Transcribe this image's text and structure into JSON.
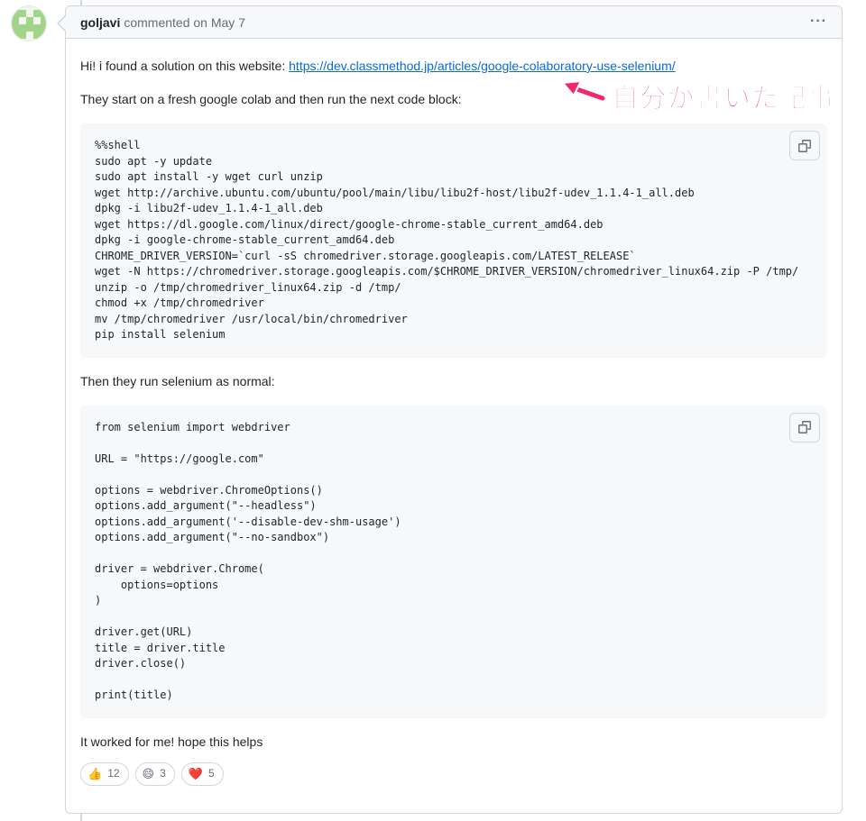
{
  "comment": {
    "author": "goljavi",
    "meta": "commented on May 7",
    "more_icon": "kebab-horizontal-icon",
    "intro_text": "Hi! i found a solution on this website: ",
    "link_text": "https://dev.classmethod.jp/articles/google-colaboratory-use-selenium/",
    "para2": "They start on a fresh google colab and then run the next code block:",
    "code1": "%%shell\nsudo apt -y update\nsudo apt install -y wget curl unzip\nwget http://archive.ubuntu.com/ubuntu/pool/main/libu/libu2f-host/libu2f-udev_1.1.4-1_all.deb\ndpkg -i libu2f-udev_1.1.4-1_all.deb\nwget https://dl.google.com/linux/direct/google-chrome-stable_current_amd64.deb\ndpkg -i google-chrome-stable_current_amd64.deb\nCHROME_DRIVER_VERSION=`curl -sS chromedriver.storage.googleapis.com/LATEST_RELEASE`\nwget -N https://chromedriver.storage.googleapis.com/$CHROME_DRIVER_VERSION/chromedriver_linux64.zip -P /tmp/\nunzip -o /tmp/chromedriver_linux64.zip -d /tmp/\nchmod +x /tmp/chromedriver\nmv /tmp/chromedriver /usr/local/bin/chromedriver\npip install selenium",
    "para3": "Then they run selenium as normal:",
    "code2": "from selenium import webdriver\n\nURL = \"https://google.com\"\n\noptions = webdriver.ChromeOptions()\noptions.add_argument(\"--headless\")\noptions.add_argument('--disable-dev-shm-usage')\noptions.add_argument(\"--no-sandbox\")\n\ndriver = webdriver.Chrome(\n    options=options\n)\n\ndriver.get(URL)\ntitle = driver.title\ndriver.close()\n\nprint(title)",
    "para4": "It worked for me! hope this helps",
    "reactions": [
      {
        "emoji": "👍",
        "count": "12"
      },
      {
        "emoji": "😄",
        "count": "3"
      },
      {
        "emoji": "❤️",
        "count": "5"
      }
    ]
  },
  "annotation": {
    "text": "自分が書いた記事",
    "color": "#ee2a6c"
  },
  "colors": {
    "link": "#0969da",
    "border": "#d0d7de",
    "header_bg": "#f6f8fa",
    "avatar": "#a3d48c"
  }
}
